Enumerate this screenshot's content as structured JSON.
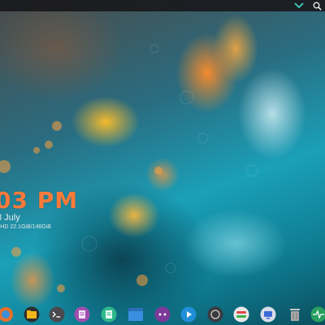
{
  "top_panel": {
    "icons": [
      "chevron-down-icon",
      "search-icon"
    ],
    "accent": "#3fd0c4"
  },
  "clock": {
    "time": "03 PM",
    "date": "8 July",
    "disk": "- HD 22.1GiB/146GiB",
    "time_color": "#ff7a3a"
  },
  "dock": {
    "items": [
      "browser-icon",
      "folder-icon",
      "terminal-icon",
      "text-editor-icon",
      "notes-icon",
      "window-icon",
      "games-icon",
      "media-player-icon",
      "circle-icon",
      "settings-toggle-icon",
      "system-info-icon",
      "trash-icon",
      "system-monitor-icon"
    ]
  }
}
